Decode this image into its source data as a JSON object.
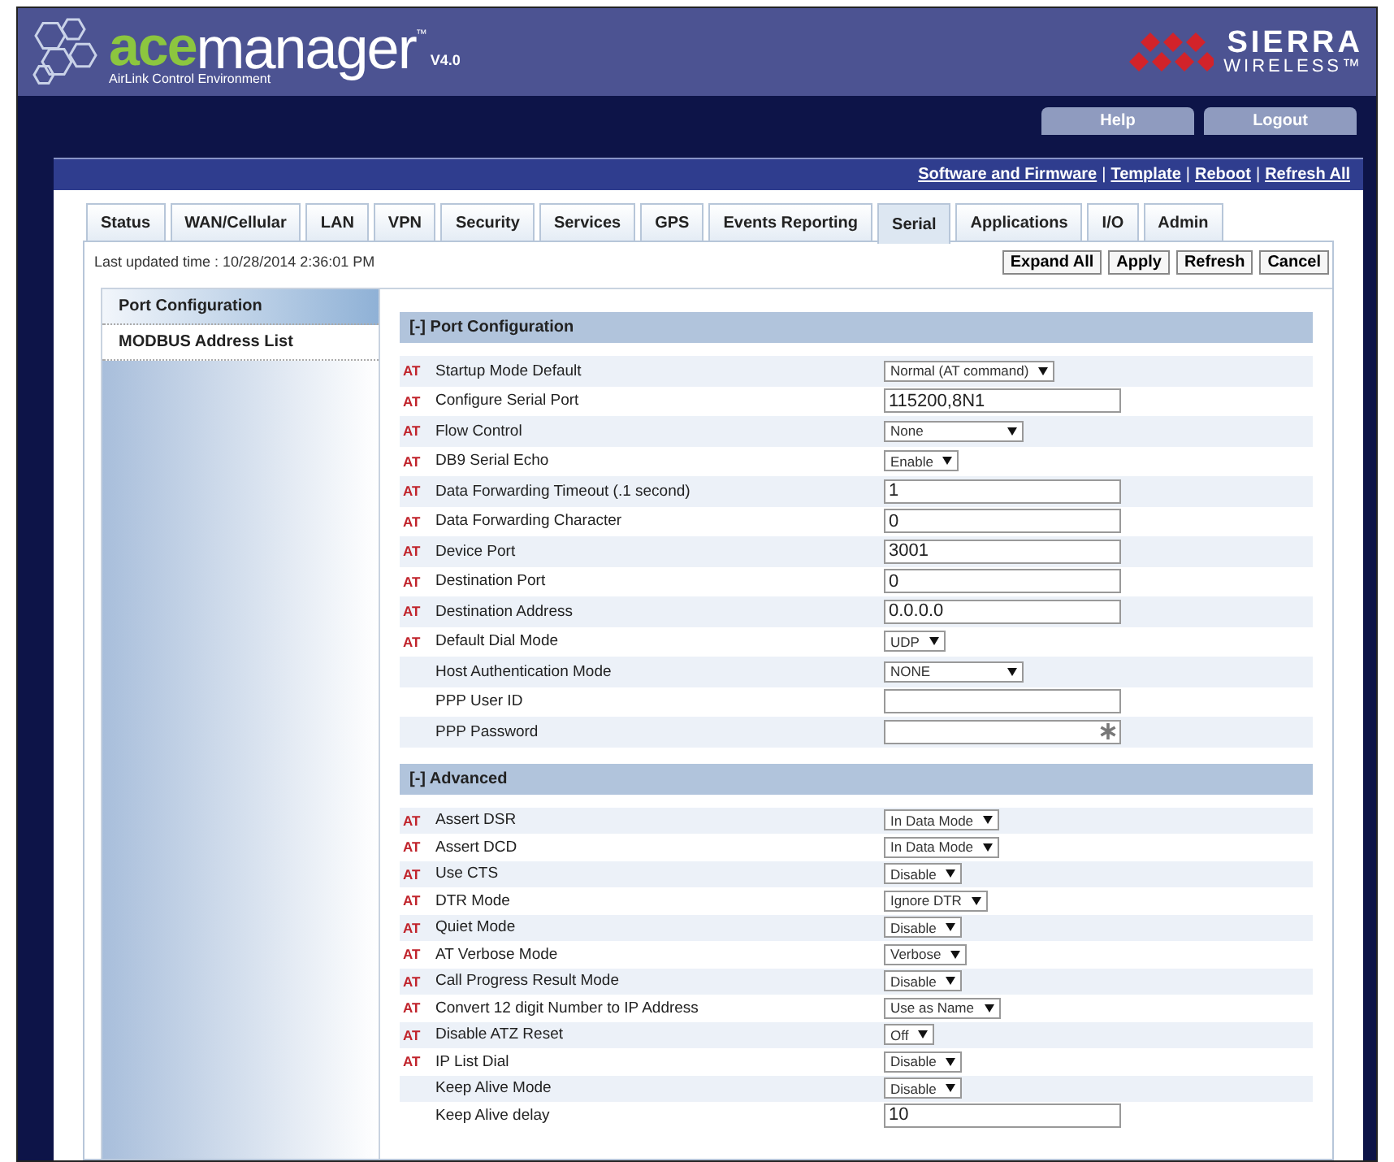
{
  "header": {
    "logo_prefix": "ace",
    "logo_name": "manager",
    "trademark": "™",
    "version": "V4.0",
    "tagline": "AirLink Control Environment",
    "brand_line1": "SIERRA",
    "brand_line2": "WIRELESS™"
  },
  "top_buttons": [
    "Help",
    "Logout"
  ],
  "links": {
    "separator": "|",
    "items": [
      "Software and Firmware",
      "Template",
      "Reboot",
      "Refresh All"
    ]
  },
  "tabs": [
    {
      "label": "Status",
      "selected": false
    },
    {
      "label": "WAN/Cellular",
      "selected": false
    },
    {
      "label": "LAN",
      "selected": false
    },
    {
      "label": "VPN",
      "selected": false
    },
    {
      "label": "Security",
      "selected": false
    },
    {
      "label": "Services",
      "selected": false
    },
    {
      "label": "GPS",
      "selected": false
    },
    {
      "label": "Events Reporting",
      "selected": false
    },
    {
      "label": "Serial",
      "selected": true
    },
    {
      "label": "Applications",
      "selected": false
    },
    {
      "label": "I/O",
      "selected": false
    },
    {
      "label": "Admin",
      "selected": false
    }
  ],
  "last_updated": "Last updated time : 10/28/2014 2:36:01 PM",
  "actions": [
    "Expand All",
    "Apply",
    "Refresh",
    "Cancel"
  ],
  "sidebar": {
    "items": [
      {
        "label": "Port Configuration",
        "selected": true
      },
      {
        "label": "MODBUS Address List",
        "selected": false
      }
    ]
  },
  "sections": [
    {
      "title": "[-] Port Configuration",
      "rows": [
        {
          "tag": "AT",
          "label": "Startup Mode Default",
          "kind": "select",
          "value": "Normal (AT command)"
        },
        {
          "tag": "AT",
          "label": "Configure Serial Port",
          "kind": "text",
          "value": "115200,8N1"
        },
        {
          "tag": "AT",
          "label": "Flow Control",
          "kind": "select_wide",
          "value": "None"
        },
        {
          "tag": "AT",
          "label": "DB9 Serial Echo",
          "kind": "select",
          "value": "Enable"
        },
        {
          "tag": "AT",
          "label": "Data Forwarding Timeout (.1 second)",
          "kind": "text",
          "value": "1"
        },
        {
          "tag": "AT",
          "label": "Data Forwarding Character",
          "kind": "text",
          "value": "0"
        },
        {
          "tag": "AT",
          "label": "Device Port",
          "kind": "text",
          "value": "3001"
        },
        {
          "tag": "AT",
          "label": "Destination Port",
          "kind": "text",
          "value": "0"
        },
        {
          "tag": "AT",
          "label": "Destination Address",
          "kind": "text",
          "value": "0.0.0.0"
        },
        {
          "tag": "AT",
          "label": "Default Dial Mode",
          "kind": "select",
          "value": "UDP"
        },
        {
          "label": "Host Authentication Mode",
          "kind": "select_wide",
          "value": "NONE"
        },
        {
          "label": "PPP User ID",
          "kind": "text"
        },
        {
          "label": "PPP Password",
          "kind": "password"
        }
      ]
    },
    {
      "title": "[-] Advanced",
      "rows": [
        {
          "tag": "AT",
          "label": "Assert DSR",
          "kind": "select",
          "value": "In Data Mode"
        },
        {
          "tag": "AT",
          "label": "Assert DCD",
          "kind": "select",
          "value": "In Data Mode"
        },
        {
          "tag": "AT",
          "label": "Use CTS",
          "kind": "select",
          "value": "Disable"
        },
        {
          "tag": "AT",
          "label": "DTR Mode",
          "kind": "select",
          "value": "Ignore DTR"
        },
        {
          "tag": "AT",
          "label": "Quiet Mode",
          "kind": "select",
          "value": "Disable"
        },
        {
          "tag": "AT",
          "label": "AT Verbose Mode",
          "kind": "select",
          "value": "Verbose"
        },
        {
          "tag": "AT",
          "label": "Call Progress Result Mode",
          "kind": "select",
          "value": "Disable"
        },
        {
          "tag": "AT",
          "label": "Convert 12 digit Number to IP Address",
          "kind": "select",
          "value": "Use as Name"
        },
        {
          "tag": "AT",
          "label": "Disable ATZ Reset",
          "kind": "select",
          "value": "Off"
        },
        {
          "tag": "AT",
          "label": "IP List Dial",
          "kind": "select",
          "value": "Disable"
        },
        {
          "label": "Keep Alive Mode",
          "kind": "select",
          "value": "Disable"
        },
        {
          "label": "Keep Alive delay",
          "kind": "text",
          "value": "10"
        }
      ]
    }
  ]
}
